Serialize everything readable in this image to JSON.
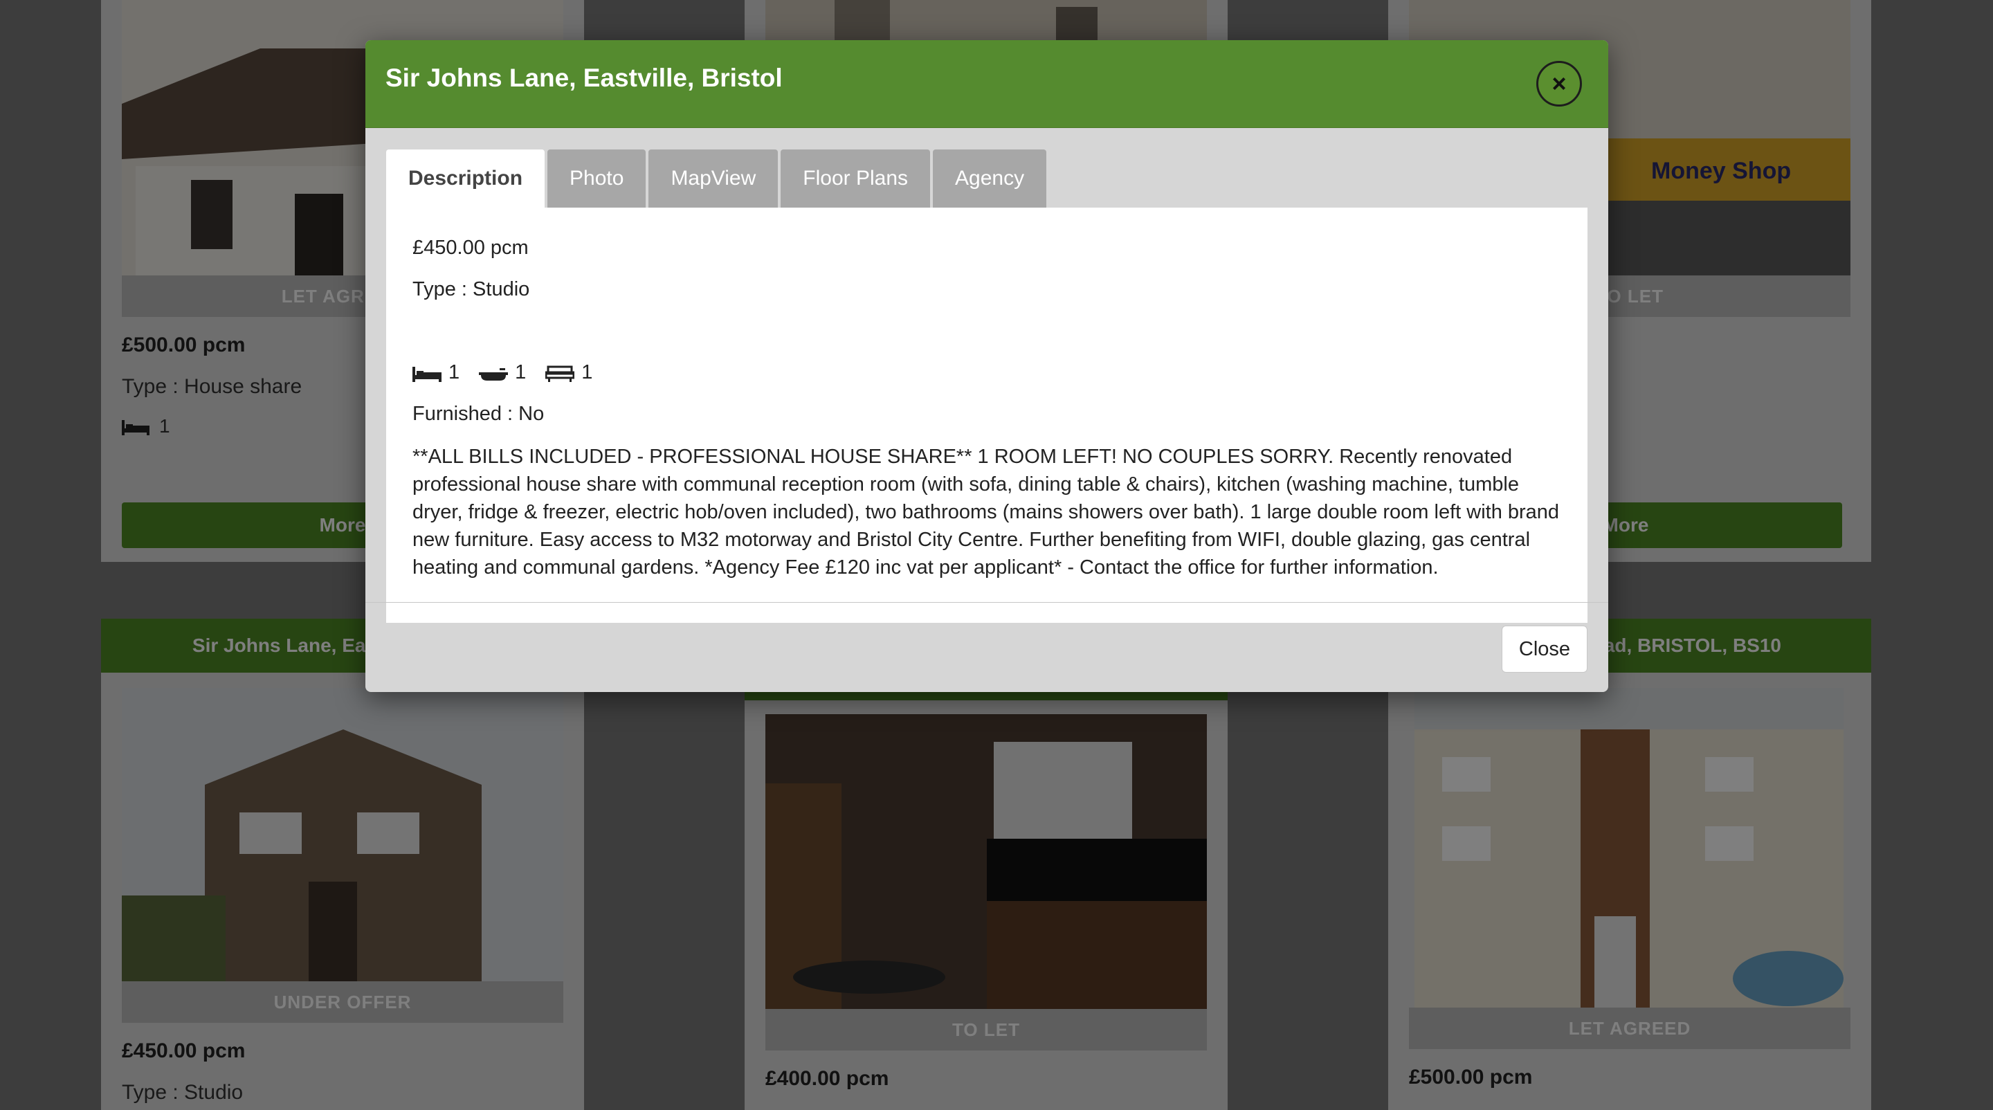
{
  "background": {
    "cards": [
      {
        "head": "",
        "status": "LET AGREED",
        "price": "£500.00 pcm",
        "type": "Type : House share",
        "beds": "1",
        "more": "More"
      },
      {
        "head": "",
        "status": "",
        "price": "",
        "type": "",
        "beds": "",
        "more": ""
      },
      {
        "head": "",
        "status": "TO LET",
        "price": "",
        "type": "",
        "beds": "",
        "more": "More"
      },
      {
        "head": "Sir Johns Lane, Eastville, Bristol",
        "status": "UNDER OFFER",
        "price": "£450.00 pcm",
        "type": "Type : Studio"
      },
      {
        "head": "",
        "status": "TO LET",
        "price": "£400.00 pcm"
      },
      {
        "head": "Road, BRISTOL, BS10",
        "status": "LET AGREED",
        "price": "£500.00 pcm"
      }
    ]
  },
  "modal": {
    "title": "Sir Johns Lane, Eastville, Bristol",
    "close_x": "×",
    "tabs": [
      "Description",
      "Photo",
      "MapView",
      "Floor Plans",
      "Agency"
    ],
    "active_tab": "Description",
    "price": "£450.00 pcm",
    "type": "Type : Studio",
    "bedrooms": "1",
    "bathrooms": "1",
    "receptions": "1",
    "furnished": "Furnished : No",
    "description": "**ALL BILLS INCLUDED - PROFESSIONAL HOUSE SHARE** 1 ROOM LEFT! NO COUPLES SORRY. Recently renovated professional house share with communal reception room (with sofa, dining table & chairs), kitchen (washing machine, tumble dryer, fridge & freezer, electric hob/oven included), two bathrooms (mains showers over bath). 1 large double room left with brand new furniture. Easy access to M32 motorway and Bristol City Centre. Further benefiting from WIFI, double glazing, gas central heating and communal gardens. *Agency Fee £120 inc vat per applicant* - Contact the office for further information.",
    "close_button": "Close"
  },
  "colors": {
    "header_green": "#558b2f",
    "button_green": "#4f8a25"
  }
}
